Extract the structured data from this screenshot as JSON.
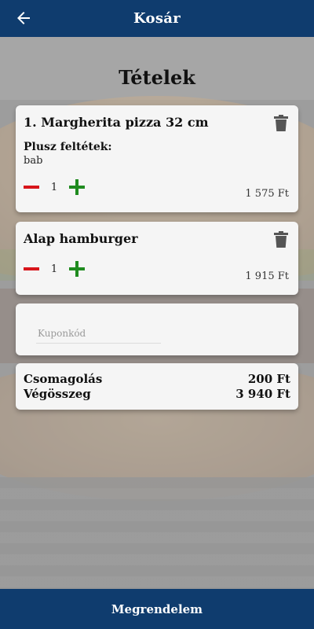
{
  "header": {
    "title": "Kosár",
    "back_icon": "arrow-left-icon"
  },
  "section_title": "Tételek",
  "items": [
    {
      "name": "1. Margherita pizza 32 cm",
      "extras_label": "Plusz feltétek:",
      "extras_value": "bab",
      "quantity": "1",
      "price": "1 575 Ft"
    },
    {
      "name": "Alap hamburger",
      "quantity": "1",
      "price": "1 915 Ft"
    }
  ],
  "coupon": {
    "placeholder": "Kuponkód",
    "value": ""
  },
  "totals": {
    "packaging_label": "Csomagolás",
    "packaging_value": "200 Ft",
    "total_label": "Végösszeg",
    "total_value": "3 940 Ft"
  },
  "order_button": "Megrendelem",
  "colors": {
    "primary": "#0f3c6e",
    "minus": "#d8151b",
    "plus": "#1f8b1f",
    "card": "#f5f5f5"
  }
}
